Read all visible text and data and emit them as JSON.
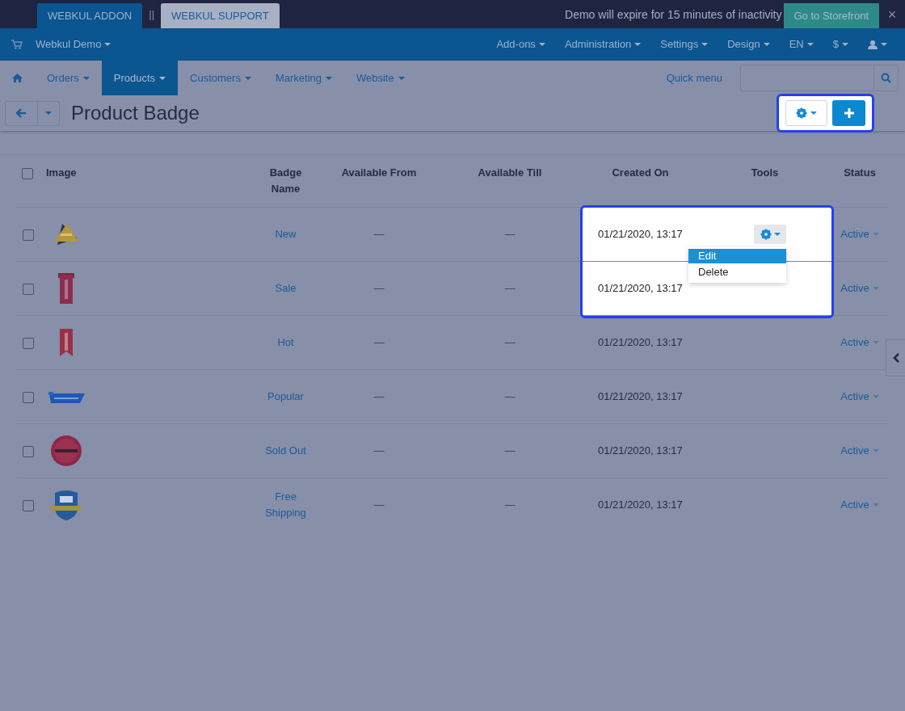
{
  "topbar": {
    "buttons": [
      {
        "label": "WEBKUL ADDON",
        "kind": "primary"
      },
      {
        "label": "WEBKUL SUPPORT",
        "kind": "light"
      }
    ],
    "separator": "||",
    "notice": "Demo will expire for 15 minutes of inactivity",
    "storefront_button": "Go to Storefront",
    "close": "×"
  },
  "store": {
    "name": "Webkul Demo"
  },
  "admin_menu": [
    {
      "label": "Add-ons"
    },
    {
      "label": "Administration"
    },
    {
      "label": "Settings"
    },
    {
      "label": "Design"
    },
    {
      "label": "EN"
    },
    {
      "label": "$"
    }
  ],
  "main_menu": [
    {
      "label": "Orders",
      "selected": false
    },
    {
      "label": "Products",
      "selected": true
    },
    {
      "label": "Customers",
      "selected": false
    },
    {
      "label": "Marketing",
      "selected": false
    },
    {
      "label": "Website",
      "selected": false
    }
  ],
  "quick_menu": "Quick menu",
  "page": {
    "title": "Product Badge",
    "toolbar_highlighted": true
  },
  "table": {
    "select_all_checked": false,
    "columns": [
      "Image",
      "Badge Name",
      "Available From",
      "Available Till",
      "Created On",
      "Tools",
      "Status"
    ],
    "rows": [
      {
        "checked": false,
        "name": "New",
        "available_from": "—",
        "available_till": "—",
        "created_on": "01/21/2020, 13:17",
        "status": "Active",
        "highlighted": true,
        "tools_menu": {
          "items": [
            {
              "label": "Edit",
              "selected": true
            },
            {
              "label": "Delete",
              "selected": false
            }
          ]
        }
      },
      {
        "checked": false,
        "name": "Sale",
        "available_from": "—",
        "available_till": "—",
        "created_on": "01/21/2020, 13:17",
        "status": "Active",
        "highlighted": true
      },
      {
        "checked": false,
        "name": "Hot",
        "available_from": "—",
        "available_till": "—",
        "created_on": "01/21/2020, 13:17",
        "status": "Active",
        "highlighted": false
      },
      {
        "checked": false,
        "name": "Popular",
        "available_from": "—",
        "available_till": "—",
        "created_on": "01/21/2020, 13:17",
        "status": "Active",
        "highlighted": false
      },
      {
        "checked": false,
        "name": "Sold Out",
        "available_from": "—",
        "available_till": "—",
        "created_on": "01/21/2020, 13:17",
        "status": "Active",
        "highlighted": false
      },
      {
        "checked": false,
        "name": "Free Shipping",
        "available_from": "—",
        "available_till": "—",
        "created_on": "01/21/2020, 13:17",
        "status": "Active",
        "highlighted": false
      }
    ]
  }
}
